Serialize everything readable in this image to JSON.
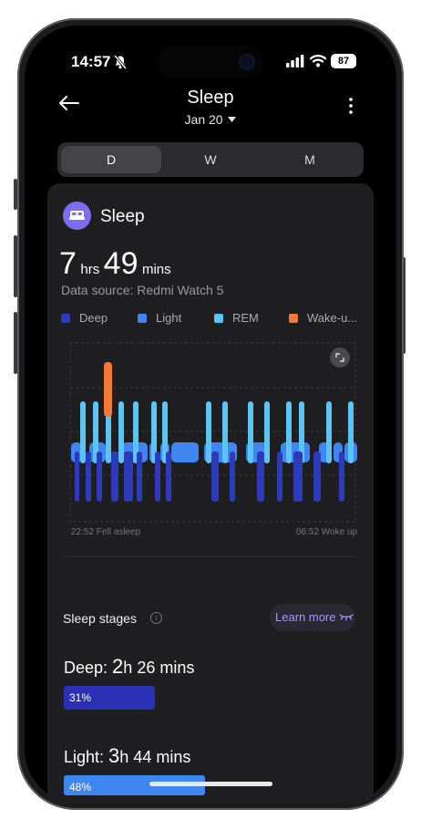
{
  "status": {
    "time": "14:57",
    "battery": "87"
  },
  "header": {
    "title": "Sleep",
    "date": "Jan 20"
  },
  "tabs": [
    {
      "label": "D",
      "active": true
    },
    {
      "label": "W",
      "active": false
    },
    {
      "label": "M",
      "active": false
    }
  ],
  "card": {
    "title": "Sleep",
    "duration": {
      "hours": "7",
      "hours_unit": "hrs",
      "minutes": "49",
      "minutes_unit": "mins"
    },
    "source": "Data source: Redmi Watch 5"
  },
  "legend": [
    {
      "label": "Deep",
      "color": "#2d3bb8"
    },
    {
      "label": "Light",
      "color": "#3f86f0"
    },
    {
      "label": "REM",
      "color": "#5cc4f5"
    },
    {
      "label": "Wake-u...",
      "color": "#ee7a3c"
    }
  ],
  "chart_data": {
    "type": "area",
    "stages": [
      "Deep",
      "Light",
      "REM",
      "Wake-up"
    ],
    "start_label": "22:52 Fell asleep",
    "end_label": "06:52 Woke up",
    "colors": {
      "Deep": "#2d3bb8",
      "Light": "#3f86f0",
      "REM": "#5cc4f5",
      "Wake-up": "#ee7a3c"
    }
  },
  "sleep_stages": {
    "title": "Sleep stages",
    "learn_more": "Learn more",
    "deep": {
      "label": "Deep: ",
      "hours": "2",
      "h_unit": "h ",
      "minutes": "26 mins",
      "percent": "31%",
      "color": "#2b2fb4",
      "fraction": 0.31
    },
    "light": {
      "label": "Light: ",
      "hours": "3",
      "h_unit": "h ",
      "minutes": "44 mins",
      "percent": "48%",
      "color": "#3f86f0",
      "fraction": 0.48
    }
  }
}
